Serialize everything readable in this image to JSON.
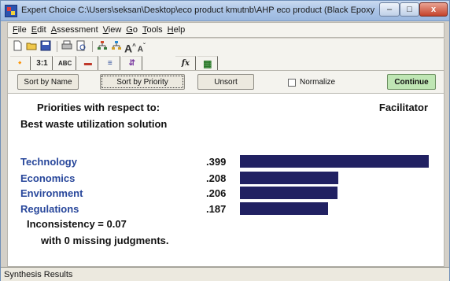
{
  "window": {
    "title": "Expert Choice    C:\\Users\\seksan\\Desktop\\eco product kmutnb\\AHP eco product (Black Epoxy Resin...",
    "minimize": "–",
    "maximize": "□",
    "close": "x"
  },
  "menu": [
    {
      "u": "F",
      "rest": "ile"
    },
    {
      "u": "E",
      "rest": "dit"
    },
    {
      "u": "A",
      "rest": "ssessment"
    },
    {
      "u": "V",
      "rest": "iew"
    },
    {
      "u": "G",
      "rest": "o"
    },
    {
      "u": "T",
      "rest": "ools"
    },
    {
      "u": "H",
      "rest": "elp"
    }
  ],
  "toolbar_icons": [
    "new-file-icon",
    "open-folder-icon",
    "save-icon",
    "print-icon",
    "print-preview-icon",
    "tree-icon",
    "sort-icon",
    "font-larger-icon",
    "font-smaller-icon"
  ],
  "tabs": [
    {
      "icon": "pairwise-icon",
      "label": "🔸"
    },
    {
      "icon": "numerical-icon",
      "label": "3:1"
    },
    {
      "icon": "verbal-icon",
      "label": "ABC"
    },
    {
      "icon": "graphical-icon",
      "label": "▬"
    },
    {
      "icon": "questionnaire-icon",
      "label": "≡"
    },
    {
      "icon": "direct-icon",
      "label": "⇵"
    },
    {
      "icon": "formula-icon",
      "label": "fx"
    },
    {
      "icon": "data-grid-icon",
      "label": "▦"
    }
  ],
  "buttons": {
    "sort_by_name": "Sort by Name",
    "sort_by_priority": "Sort by Priority",
    "unsort": "Unsort",
    "normalize": "Normalize",
    "continue": "Continue"
  },
  "content": {
    "title": "Priorities with respect to:",
    "facilitator": "Facilitator",
    "goal": "Best waste utilization solution",
    "bar_color": "#212162",
    "label_color": "#28479b",
    "priorities": [
      {
        "name": "Technology",
        "value_text": ".399",
        "value": 0.399
      },
      {
        "name": "Economics",
        "value_text": ".208",
        "value": 0.208
      },
      {
        "name": "Environment",
        "value_text": ".206",
        "value": 0.206
      },
      {
        "name": "Regulations",
        "value_text": ".187",
        "value": 0.187
      }
    ],
    "inconsistency": "Inconsistency = 0.07",
    "missing": "with 0  missing judgments."
  },
  "status": "Synthesis Results"
}
